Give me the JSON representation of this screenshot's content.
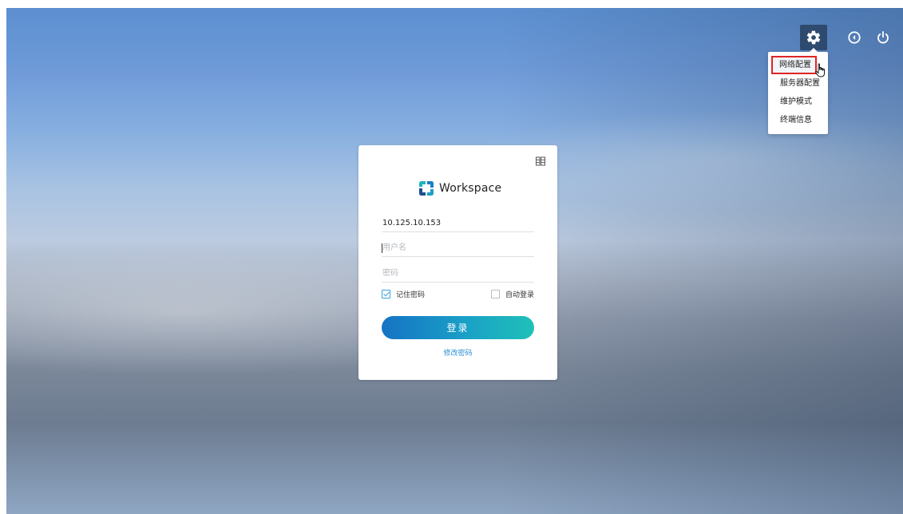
{
  "top_controls": {
    "settings_icon": "gear-icon",
    "back_icon": "circle-back-icon",
    "power_icon": "power-icon"
  },
  "settings_menu": {
    "items": [
      {
        "label": "网络配置",
        "highlighted": true
      },
      {
        "label": "服务器配置",
        "highlighted": false
      },
      {
        "label": "维护模式",
        "highlighted": false
      },
      {
        "label": "终端信息",
        "highlighted": false
      }
    ]
  },
  "login": {
    "brand_name": "Workspace",
    "server_address": "10.125.10.153",
    "username_placeholder": "用户名",
    "password_placeholder": "密码",
    "remember_password_label": "记住密码",
    "remember_password_checked": true,
    "auto_login_label": "自动登录",
    "auto_login_checked": false,
    "login_button_label": "登录",
    "change_password_link": "修改密码"
  },
  "colors": {
    "accent": "#1aa0c7",
    "button_gradient_start": "#1573c4",
    "button_gradient_end": "#1fc1b8",
    "link": "#2b8fd4",
    "menu_highlight_border": "#e02424",
    "settings_button_bg": "#2e4a6e"
  }
}
